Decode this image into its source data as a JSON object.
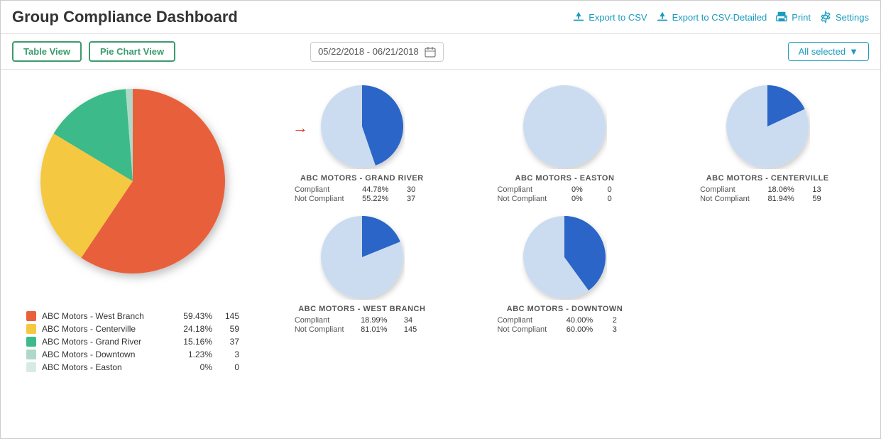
{
  "header": {
    "title": "Group Compliance Dashboard",
    "actions": [
      {
        "id": "export-csv",
        "label": "Export to CSV",
        "icon": "export-icon"
      },
      {
        "id": "export-csv-detailed",
        "label": "Export to CSV-Detailed",
        "icon": "export-icon"
      },
      {
        "id": "print",
        "label": "Print",
        "icon": "print-icon"
      },
      {
        "id": "settings",
        "label": "Settings",
        "icon": "settings-icon"
      }
    ]
  },
  "toolbar": {
    "table_view_label": "Table View",
    "pie_chart_view_label": "Pie Chart View",
    "date_range": "05/22/2018 - 06/21/2018",
    "all_selected_label": "All selected"
  },
  "main_pie": {
    "segments": [
      {
        "name": "ABC Motors - West Branch",
        "color": "#e8613a",
        "pct": "59.43%",
        "val": "145",
        "degrees": 214
      },
      {
        "name": "ABC Motors - Centerville",
        "color": "#f5c842",
        "pct": "24.18%",
        "val": "59",
        "degrees": 87
      },
      {
        "name": "ABC Motors - Grand River",
        "color": "#3dba8a",
        "pct": "15.16%",
        "val": "37",
        "degrees": 55
      },
      {
        "name": "ABC Motors - Downtown",
        "color": "#b0d8c8",
        "pct": "1.23%",
        "val": "3",
        "degrees": 5
      },
      {
        "name": "ABC Motors - Easton",
        "color": "#d8eae4",
        "pct": "0%",
        "val": "0",
        "degrees": 0
      }
    ]
  },
  "small_charts": [
    {
      "id": "grand-river",
      "name": "ABC MOTORS - GRAND RIVER",
      "compliant_pct": "44.78%",
      "compliant_val": "30",
      "not_compliant_pct": "55.22%",
      "not_compliant_val": "37",
      "compliant_deg": 161,
      "has_arrow": true
    },
    {
      "id": "easton",
      "name": "ABC MOTORS - EASTON",
      "compliant_pct": "0%",
      "compliant_val": "0",
      "not_compliant_pct": "0%",
      "not_compliant_val": "0",
      "compliant_deg": 0,
      "has_arrow": false
    },
    {
      "id": "centerville",
      "name": "ABC MOTORS - CENTERVILLE",
      "compliant_pct": "18.06%",
      "compliant_val": "13",
      "not_compliant_pct": "81.94%",
      "not_compliant_val": "59",
      "compliant_deg": 65,
      "has_arrow": false
    },
    {
      "id": "west-branch",
      "name": "ABC MOTORS - WEST BRANCH",
      "compliant_pct": "18.99%",
      "compliant_val": "34",
      "not_compliant_pct": "81.01%",
      "not_compliant_val": "145",
      "compliant_deg": 68,
      "has_arrow": false
    },
    {
      "id": "downtown",
      "name": "ABC MOTORS - DOWNTOWN",
      "compliant_pct": "40.00%",
      "compliant_val": "2",
      "not_compliant_pct": "60.00%",
      "not_compliant_val": "3",
      "compliant_deg": 144,
      "has_arrow": false
    }
  ],
  "labels": {
    "compliant": "Compliant",
    "not_compliant": "Not Compliant"
  },
  "colors": {
    "compliant": "#2b65c7",
    "not_compliant": "#ccdcf0",
    "accent": "#1a9bbd",
    "green": "#3d9b6e"
  }
}
